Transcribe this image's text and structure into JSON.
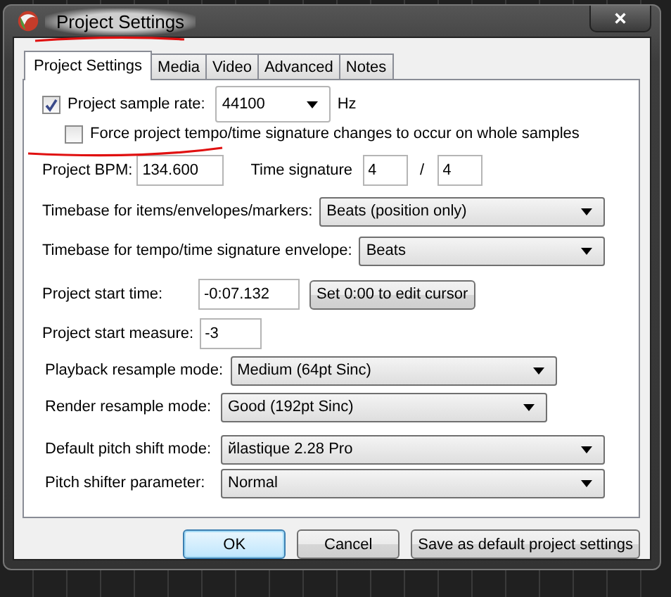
{
  "window": {
    "title": "Project Settings"
  },
  "tabs": [
    {
      "label": "Project Settings",
      "selected": true
    },
    {
      "label": "Media",
      "selected": false
    },
    {
      "label": "Video",
      "selected": false
    },
    {
      "label": "Advanced",
      "selected": false
    },
    {
      "label": "Notes",
      "selected": false
    }
  ],
  "sample_rate": {
    "label": "Project sample rate:",
    "checked": true,
    "value": "44100",
    "unit": "Hz"
  },
  "force_whole_samples": {
    "label": "Force project tempo/time signature changes to occur on whole samples",
    "checked": false
  },
  "bpm": {
    "label": "Project BPM:",
    "value": "134.600"
  },
  "time_signature": {
    "label": "Time signature",
    "numerator": "4",
    "separator": "/",
    "denominator": "4"
  },
  "timebase": [
    {
      "label": "Timebase for items/envelopes/markers:",
      "value": "Beats (position only)"
    },
    {
      "label": "Timebase for tempo/time signature envelope:",
      "value": "Beats"
    }
  ],
  "start_time": {
    "label": "Project start time:",
    "value": "-0:07.132",
    "button": "Set 0:00 to edit cursor"
  },
  "start_measure": {
    "label": "Project start measure:",
    "value": "-3"
  },
  "resample": [
    {
      "label": "Playback resample mode:",
      "value": "Medium (64pt Sinc)"
    },
    {
      "label": "Render resample mode:",
      "value": "Good (192pt Sinc)"
    }
  ],
  "pitch": [
    {
      "label": "Default pitch shift mode:",
      "value": "йlastique 2.28 Pro"
    },
    {
      "label": "Pitch shifter parameter:",
      "value": "Normal"
    }
  ],
  "buttons": [
    {
      "label": "OK",
      "default": true
    },
    {
      "label": "Cancel",
      "default": false
    },
    {
      "label": "Save as default project settings",
      "default": false
    }
  ]
}
